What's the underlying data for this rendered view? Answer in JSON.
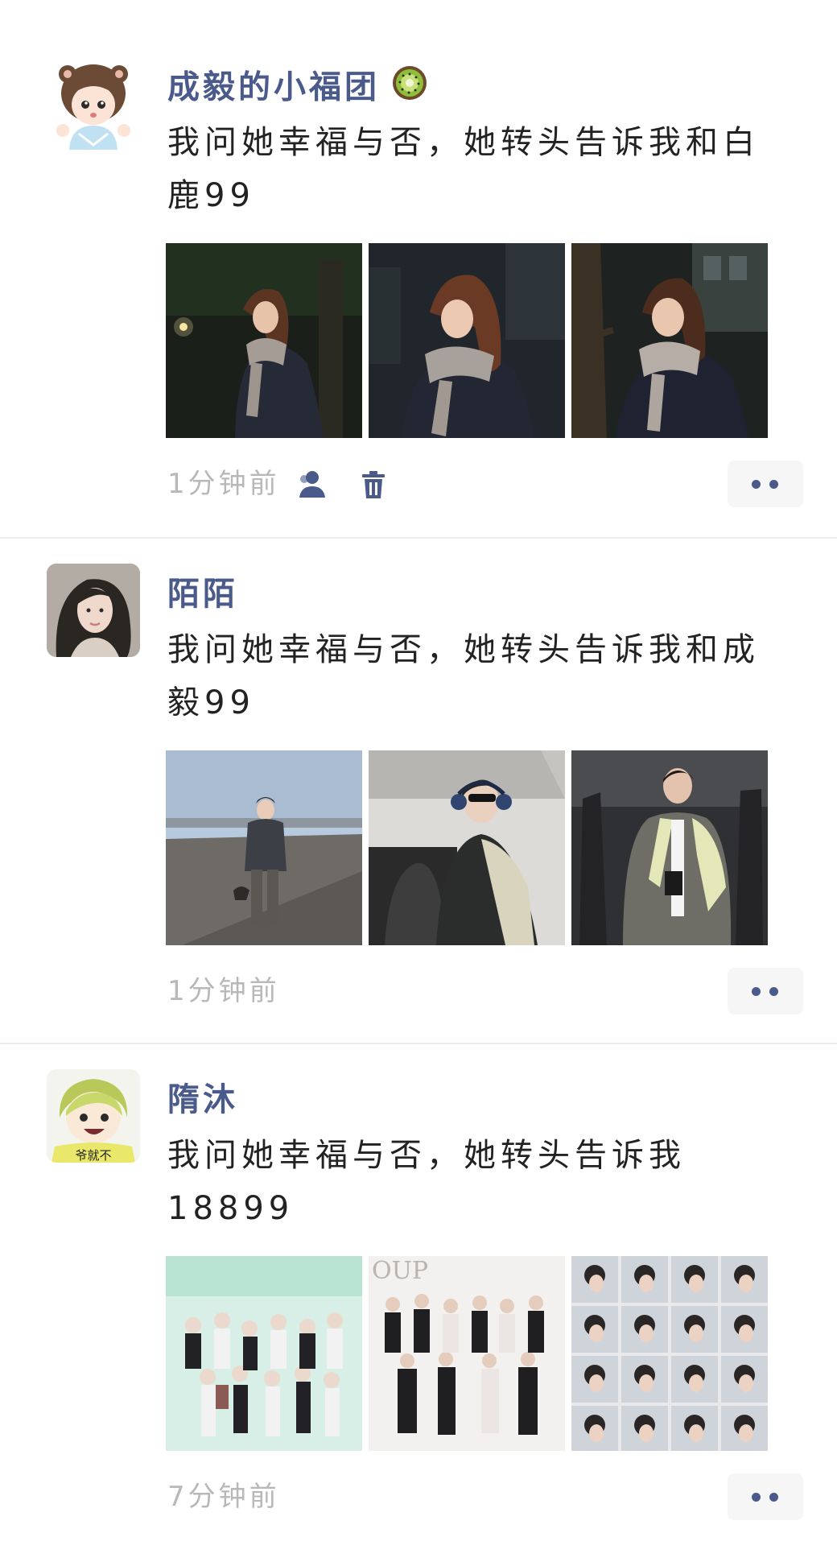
{
  "colors": {
    "username": "#4a5a8b",
    "body_text": "#222222",
    "timestamp": "#b8b8b8",
    "divider": "#ececec",
    "more_button_bg": "#f6f6f6"
  },
  "posts": [
    {
      "author": "成毅的小福团",
      "author_emoji": "kiwi-emoji",
      "text": "我问她幸福与否，她转头告诉我和白鹿99",
      "image_count": 3,
      "time": "1分钟前",
      "actions": [
        "contacts-icon",
        "trash-icon"
      ],
      "more_icon": "more-dots-icon"
    },
    {
      "author": "陌陌",
      "text": "我问她幸福与否，她转头告诉我和成毅99",
      "image_count": 3,
      "time": "1分钟前",
      "more_icon": "more-dots-icon"
    },
    {
      "author": "隋沐",
      "text": "我问她幸福与否，她转头告诉我\n18899",
      "image_count": 3,
      "time": "7分钟前",
      "more_icon": "more-dots-icon"
    }
  ],
  "avatar_caption_post3": "爷就不"
}
